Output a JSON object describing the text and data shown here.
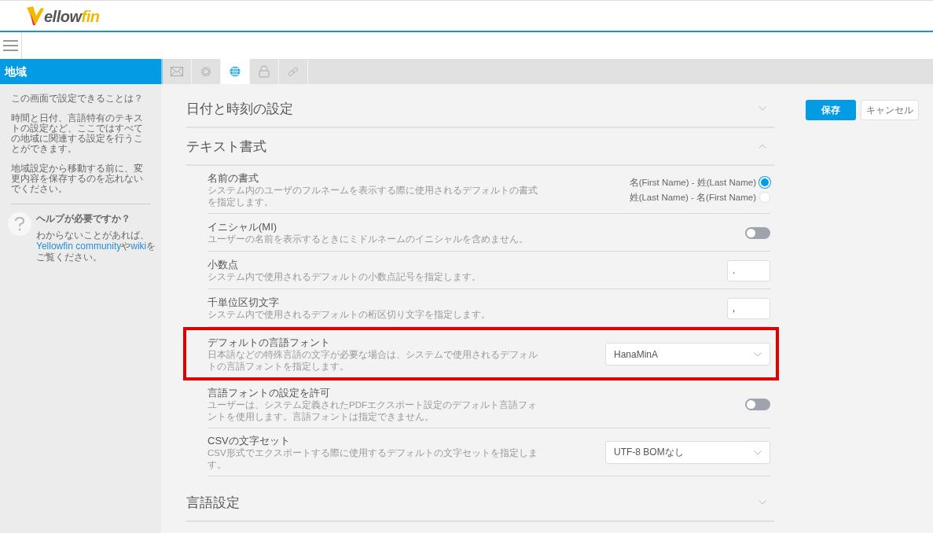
{
  "header": {
    "logo": {
      "text": "ellow",
      "accent": "fin"
    }
  },
  "sidebar": {
    "title": "地域",
    "paragraphs": [
      "この画面で設定できることは？",
      "時間と日付、言語特有のテキストの設定など、ここではすべての地域に関連する設定を行うことができます。",
      "地域設定から移動する前に、変更内容を保存するのを忘れないでください。"
    ],
    "help": {
      "title": "ヘルプが必要ですか？",
      "parts": [
        {
          "kind": "text",
          "text": "わからないことがあれば、"
        },
        {
          "kind": "link",
          "text": "Yellowfin community"
        },
        {
          "kind": "text",
          "text": "や"
        },
        {
          "kind": "link",
          "text": "wiki"
        },
        {
          "kind": "text",
          "text": "をご覧ください。"
        }
      ]
    }
  },
  "tabs": [
    {
      "kind": "mail",
      "selected": false
    },
    {
      "kind": "gear",
      "selected": false
    },
    {
      "kind": "globe",
      "selected": true
    },
    {
      "kind": "lock",
      "selected": false
    },
    {
      "kind": "link",
      "selected": false
    }
  ],
  "sections": [
    {
      "title": "日付と時刻の設定",
      "expanded": false
    },
    {
      "title": "テキスト書式",
      "expanded": true,
      "rows": [
        {
          "kind": "radio",
          "title": "名前の書式",
          "description": "システム内のユーザのフルネームを表示する際に使用されるデフォルトの書式を指定します。",
          "options": [
            {
              "label": "名(First Name) - 姓(Last Name)",
              "selected": true
            },
            {
              "label": "姓(Last Name) - 名(First Name)",
              "selected": false
            }
          ]
        },
        {
          "kind": "toggle",
          "title": "イニシャル(MI)",
          "description": "ユーザーの名前を表示するときにミドルネームのイニシャルを含めません。",
          "on": false
        },
        {
          "kind": "input",
          "title": "小数点",
          "description": "システム内で使用されるデフォルトの小数点記号を指定します。",
          "value": "."
        },
        {
          "kind": "input",
          "title": "千単位区切文字",
          "description": "システム内で使用されるデフォルトの桁区切り文字を指定します。",
          "value": ","
        },
        {
          "kind": "select",
          "title": "デフォルトの言語フォント",
          "description": "日本語などの特殊言語の文字が必要な場合は、システムで使用されるデフォルトの言語フォントを指定します。",
          "value": "HanaMinA",
          "highlighted": true
        },
        {
          "kind": "toggle",
          "title": "言語フォントの設定を許可",
          "description": "ユーザーは、システム定義されたPDFエクスポート設定のデフォルト言語フォントを使用します。言語フォントは指定できません。",
          "on": false
        },
        {
          "kind": "select",
          "title": "CSVの文字セット",
          "description": "CSV形式でエクスポートする際に使用するデフォルトの文字セットを指定します。",
          "value": "UTF-8 BOMなし"
        }
      ]
    },
    {
      "title": "言語設定",
      "expanded": false
    }
  ],
  "actions": [
    {
      "kind": "primary",
      "label": "保存"
    },
    {
      "kind": "secondary",
      "label": "キャンセル"
    }
  ]
}
